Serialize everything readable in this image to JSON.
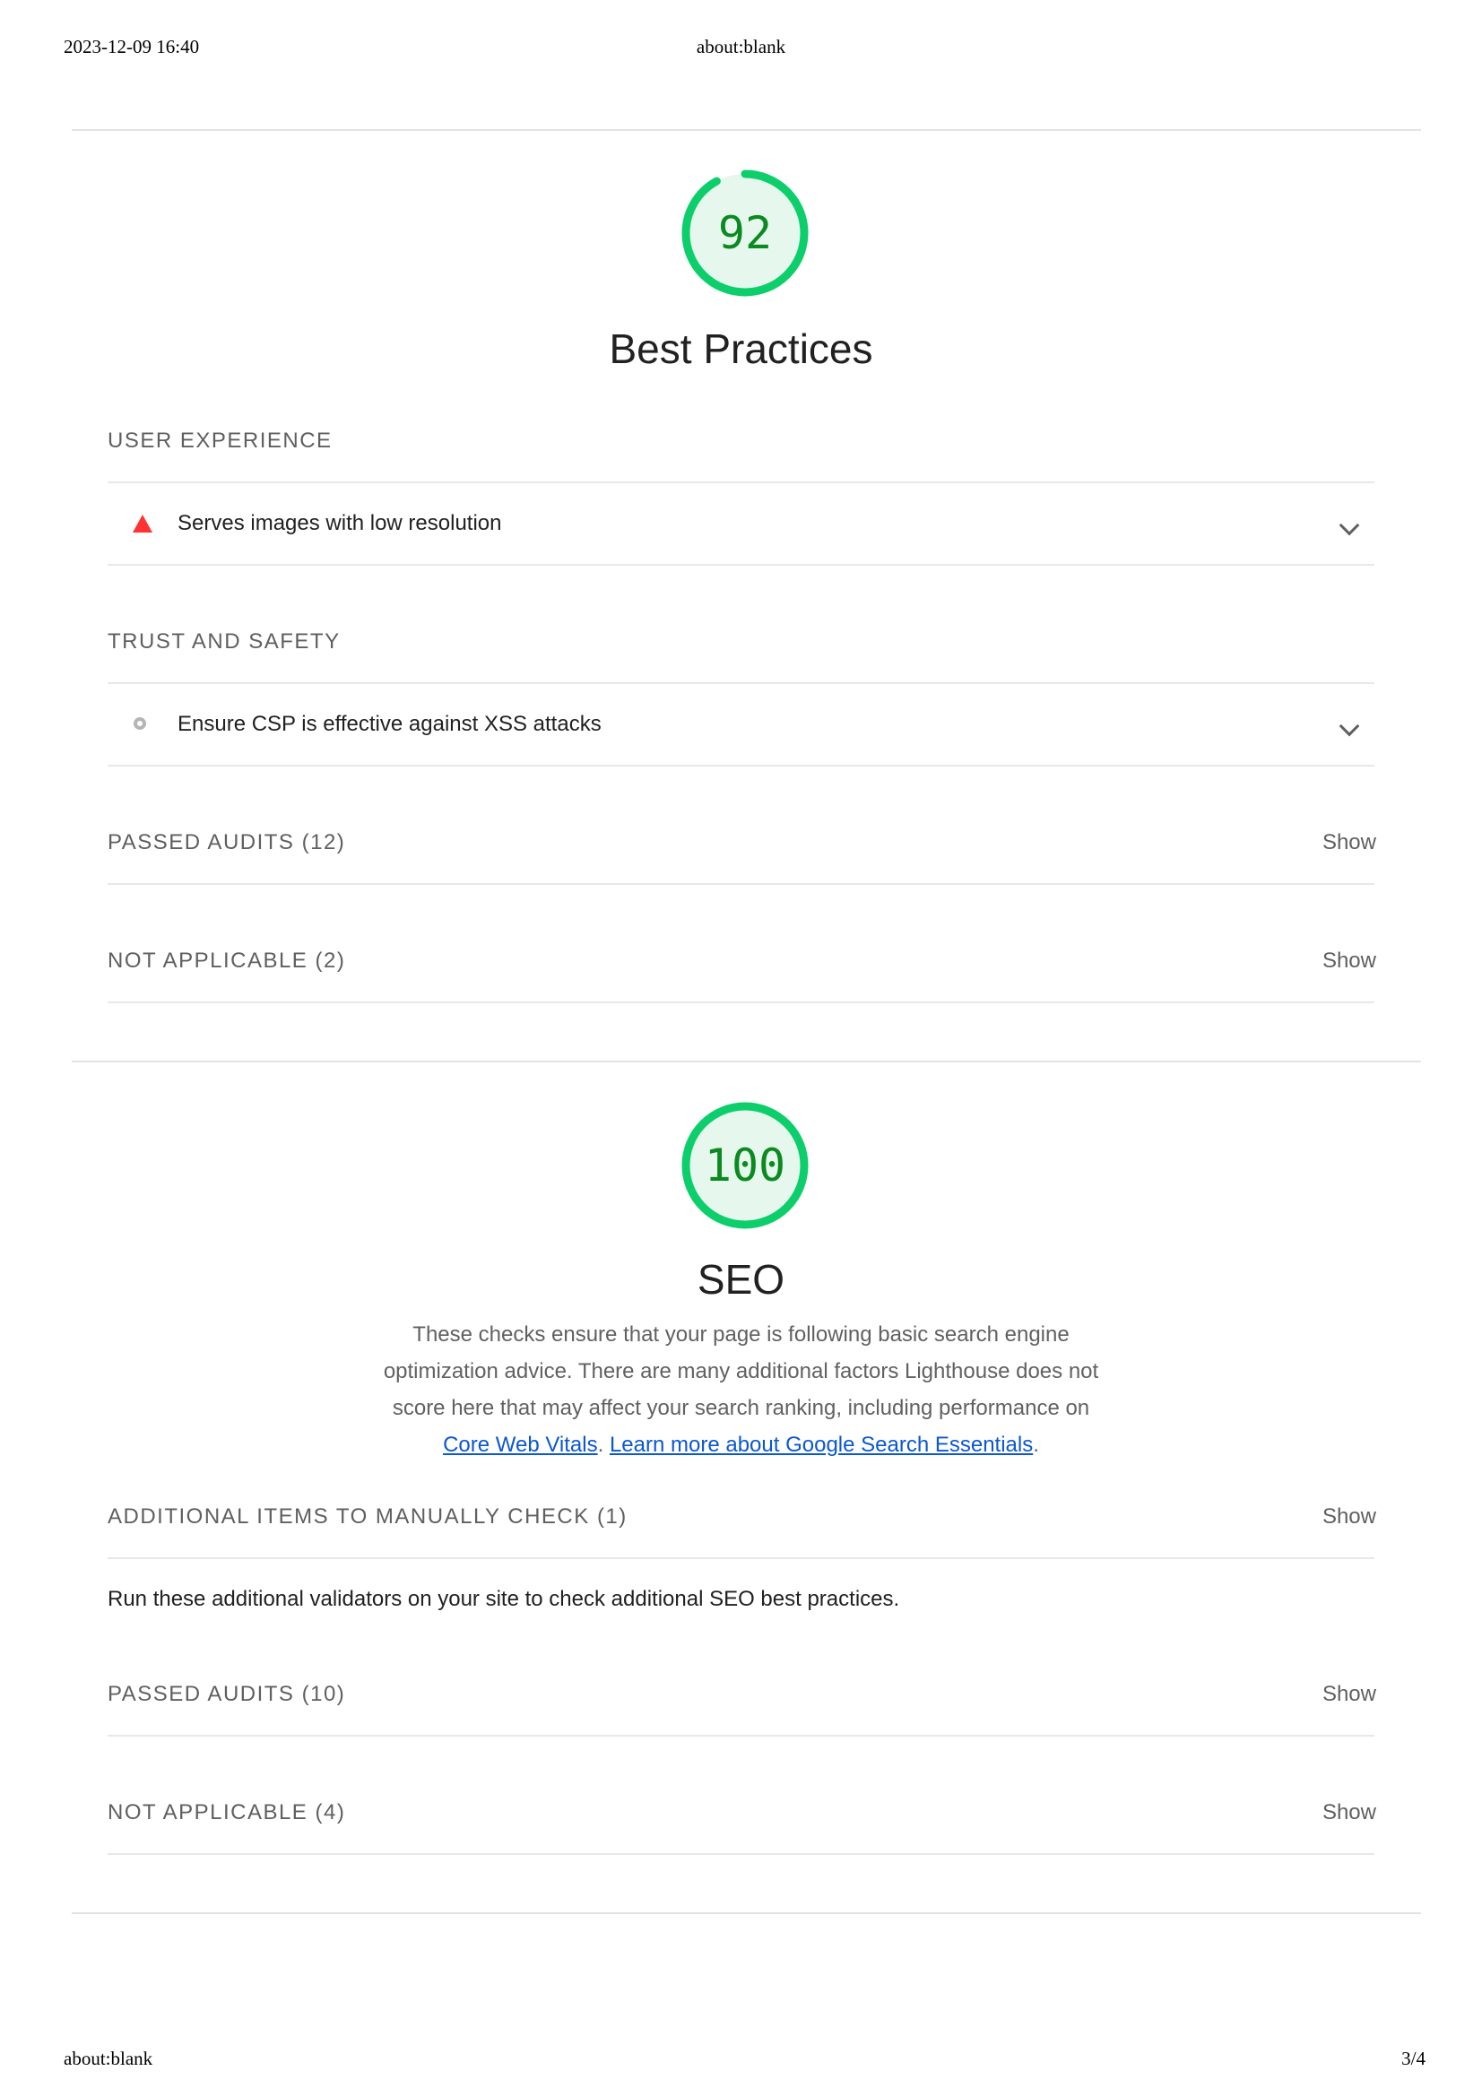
{
  "print_header": {
    "datetime": "2023-12-09 16:40",
    "title": "about:blank"
  },
  "print_footer": {
    "url": "about:blank",
    "page": "3/4"
  },
  "colors": {
    "pass": "#0cce6b",
    "pass_text": "#0a8a1f",
    "fail": "#ff3333",
    "link": "#0b57d0"
  },
  "best_practices": {
    "score": "92",
    "score_fraction": 0.92,
    "title": "Best Practices",
    "user_experience": {
      "title": "USER EXPERIENCE",
      "audit": {
        "icon": "warning-triangle-icon",
        "label": "Serves images with low resolution"
      }
    },
    "trust_and_safety": {
      "title": "TRUST AND SAFETY",
      "audit": {
        "icon": "informative-circle-icon",
        "label": "Ensure CSP is effective against XSS attacks"
      }
    },
    "passed": {
      "label": "PASSED AUDITS (12)",
      "show": "Show"
    },
    "not_applicable": {
      "label": "NOT APPLICABLE (2)",
      "show": "Show"
    }
  },
  "seo": {
    "score": "100",
    "score_fraction": 1.0,
    "title": "SEO",
    "description_before": "These checks ensure that your page is following basic search engine optimization advice. There are many additional factors Lighthouse does not score here that may affect your search ranking, including performance on ",
    "link_core_web_vitals": "Core Web Vitals",
    "description_sep": ". ",
    "link_learn_more": "Learn more about Google Search Essentials",
    "description_after": ".",
    "manual": {
      "label": "ADDITIONAL ITEMS TO MANUALLY CHECK (1)",
      "show": "Show",
      "description": "Run these additional validators on your site to check additional SEO best practices."
    },
    "passed": {
      "label": "PASSED AUDITS (10)",
      "show": "Show"
    },
    "not_applicable": {
      "label": "NOT APPLICABLE (4)",
      "show": "Show"
    }
  }
}
